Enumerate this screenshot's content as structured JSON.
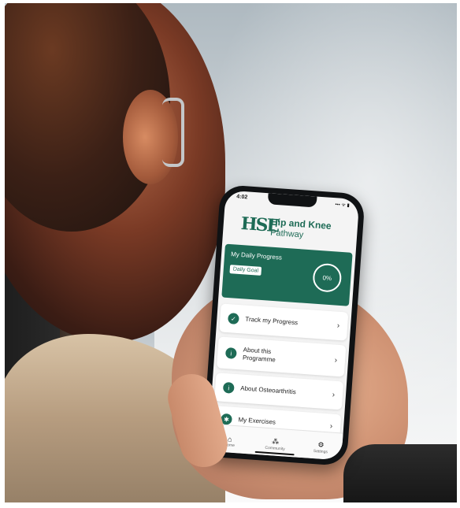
{
  "status": {
    "time": "4:02",
    "icons": "••• ᯤ ▮"
  },
  "brand": {
    "logo": "HSE",
    "title": "Hip and Knee",
    "subtitle": "Pathway",
    "color": "#1e6b56"
  },
  "progress": {
    "title": "My Daily Progress",
    "goal_label": "Daily Goal",
    "percent": "0%"
  },
  "menu": [
    {
      "icon": "check-icon",
      "glyph": "✓",
      "label": "Track my Progress"
    },
    {
      "icon": "info-icon",
      "glyph": "i",
      "label_line1": "About this",
      "label_line2": "Programme"
    },
    {
      "icon": "info-icon",
      "glyph": "i",
      "label": "About Osteoarthritis"
    },
    {
      "icon": "person-icon",
      "glyph": "✱",
      "label": "My Exercises"
    }
  ],
  "tabs": [
    {
      "icon": "home-icon",
      "glyph": "⌂",
      "label": "Home"
    },
    {
      "icon": "community-icon",
      "glyph": "⁂",
      "label": "Community"
    },
    {
      "icon": "settings-icon",
      "glyph": "⚙",
      "label": "Settings"
    }
  ]
}
